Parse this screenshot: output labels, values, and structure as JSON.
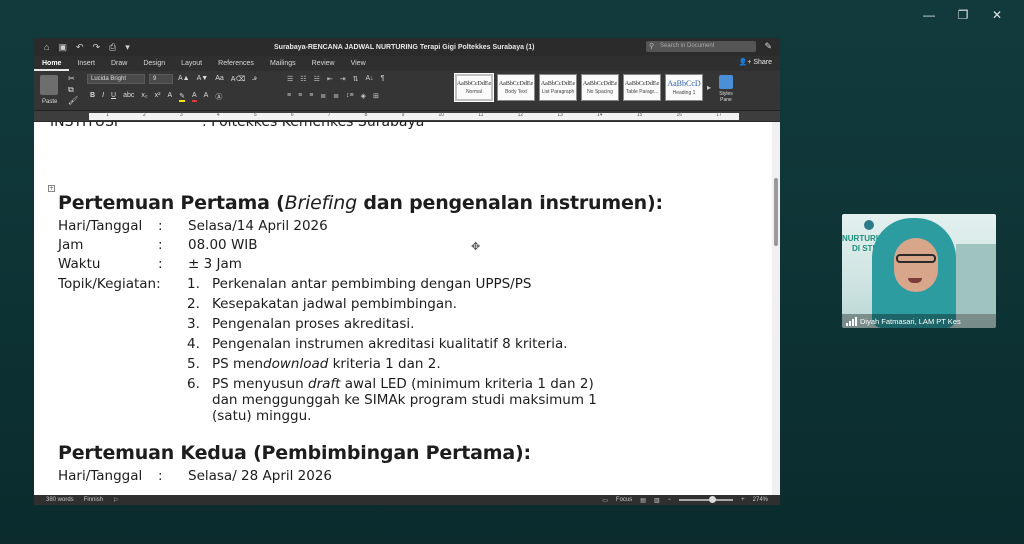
{
  "window_controls": {
    "minimize": "—",
    "restore": "❐",
    "close": "✕"
  },
  "word": {
    "doc_title": "Surabaya-RENCANA JADWAL NURTURING Terapi Gigi Poltekkes Surabaya (1)",
    "search_placeholder": "Search in Document",
    "tabs": [
      "Home",
      "Insert",
      "Draw",
      "Design",
      "Layout",
      "References",
      "Mailings",
      "Review",
      "View"
    ],
    "share_label": "Share",
    "paste_label": "Paste",
    "font_name": "Lucida Bright",
    "font_size": "9",
    "styles": [
      {
        "sample": "AaBbCcDdEe",
        "name": "Normal"
      },
      {
        "sample": "AaBbCcDdEe",
        "name": "Body Text"
      },
      {
        "sample": "AaBbCcDdEe",
        "name": "List Paragraph"
      },
      {
        "sample": "AaBbCcDdEe",
        "name": "No Spacing"
      },
      {
        "sample": "AaBbCcDdEe",
        "name": "Table Paragr..."
      },
      {
        "sample": "AaBbCcD",
        "name": "Heading 1"
      }
    ],
    "styles_pane_label": "Styles Pane",
    "ruler_numbers": [
      "1",
      "2",
      "3",
      "4",
      "5",
      "6",
      "7",
      "8",
      "9",
      "10",
      "11",
      "12",
      "13",
      "14",
      "15",
      "16",
      "17"
    ],
    "status": {
      "words": "380 words",
      "lang": "Finnish",
      "focus": "Focus",
      "zoom": "274%",
      "zoom_fraction": 0.62
    }
  },
  "document": {
    "institusi_label": "INSTITUSI",
    "institusi_value": ": Poltekkes Kemenkes Surabaya",
    "meeting1": {
      "heading_pre": "Pertemuan Pertama (",
      "heading_italic": "Briefing",
      "heading_post": " dan pengenalan instrumen):",
      "rows": [
        {
          "k": "Hari/Tanggal",
          "c": ":",
          "v": "Selasa/14  April 2026"
        },
        {
          "k": "Jam",
          "c": ":",
          "v": "08.00 WIB"
        },
        {
          "k": "Waktu",
          "c": ":",
          "v": "± 3 Jam"
        },
        {
          "k": "Topik/Kegiatan:",
          "c": "",
          "v": ""
        }
      ],
      "items": [
        {
          "n": "1.",
          "text": "Perkenalan antar pembimbing dengan UPPS/PS"
        },
        {
          "n": "2.",
          "text": "Kesepakatan jadwal pembimbingan."
        },
        {
          "n": "3.",
          "text": "Pengenalan proses akreditasi."
        },
        {
          "n": "4.",
          "text": "Pengenalan instrumen akreditasi kualitatif 8 kriteria."
        },
        {
          "n": "5.",
          "pre": "PS men",
          "it": "download",
          "post": " kriteria 1 dan 2."
        },
        {
          "n": "6.",
          "pre": "PS menyusun ",
          "it": "draft",
          "post": " awal LED (minimum kriteria 1 dan 2) dan menggunggah ke SIMAk program studi maksimum 1 (satu) minggu."
        }
      ]
    },
    "meeting2": {
      "heading": "Pertemuan Kedua (Pembimbingan Pertama):",
      "rows": [
        {
          "k": "Hari/Tanggal",
          "c": ":",
          "v": "Selasa/ 28 April 2026"
        }
      ]
    }
  },
  "video_tile": {
    "participant_name": "Diyah Fatmasari, LAM PT Kes",
    "banner_line1": "NURTURING L",
    "banner_line2": "DI STR TE"
  }
}
